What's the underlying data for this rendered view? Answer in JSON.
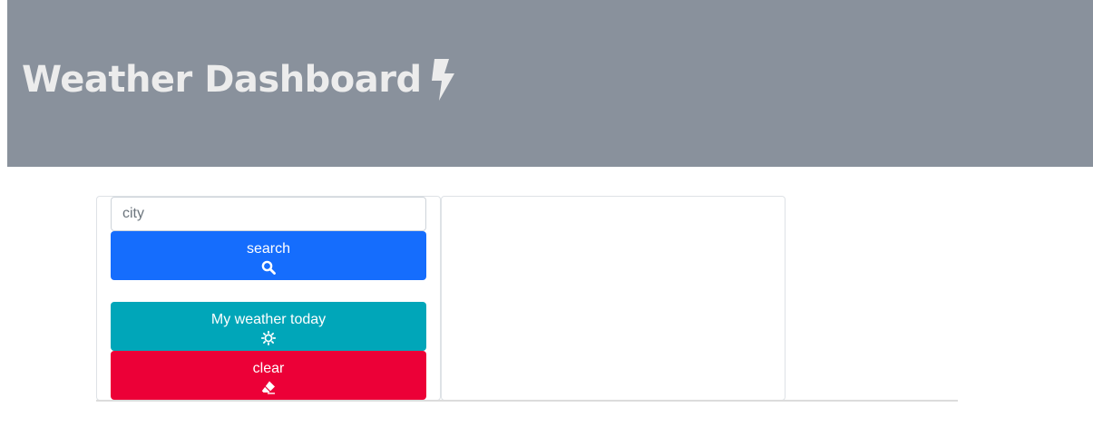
{
  "header": {
    "title": "Weather Dashboard",
    "title_icon": "bolt-icon",
    "background": "#89919c"
  },
  "search": {
    "placeholder": "city",
    "value": "",
    "button_label": "search",
    "button_icon": "search-icon",
    "button_color": "#156dfd"
  },
  "actions": {
    "weather_today_label": "My weather today",
    "weather_today_icon": "sun-icon",
    "weather_today_color": "#00a6b9",
    "clear_label": "clear",
    "clear_icon": "eraser-icon",
    "clear_color": "#ec0037"
  }
}
